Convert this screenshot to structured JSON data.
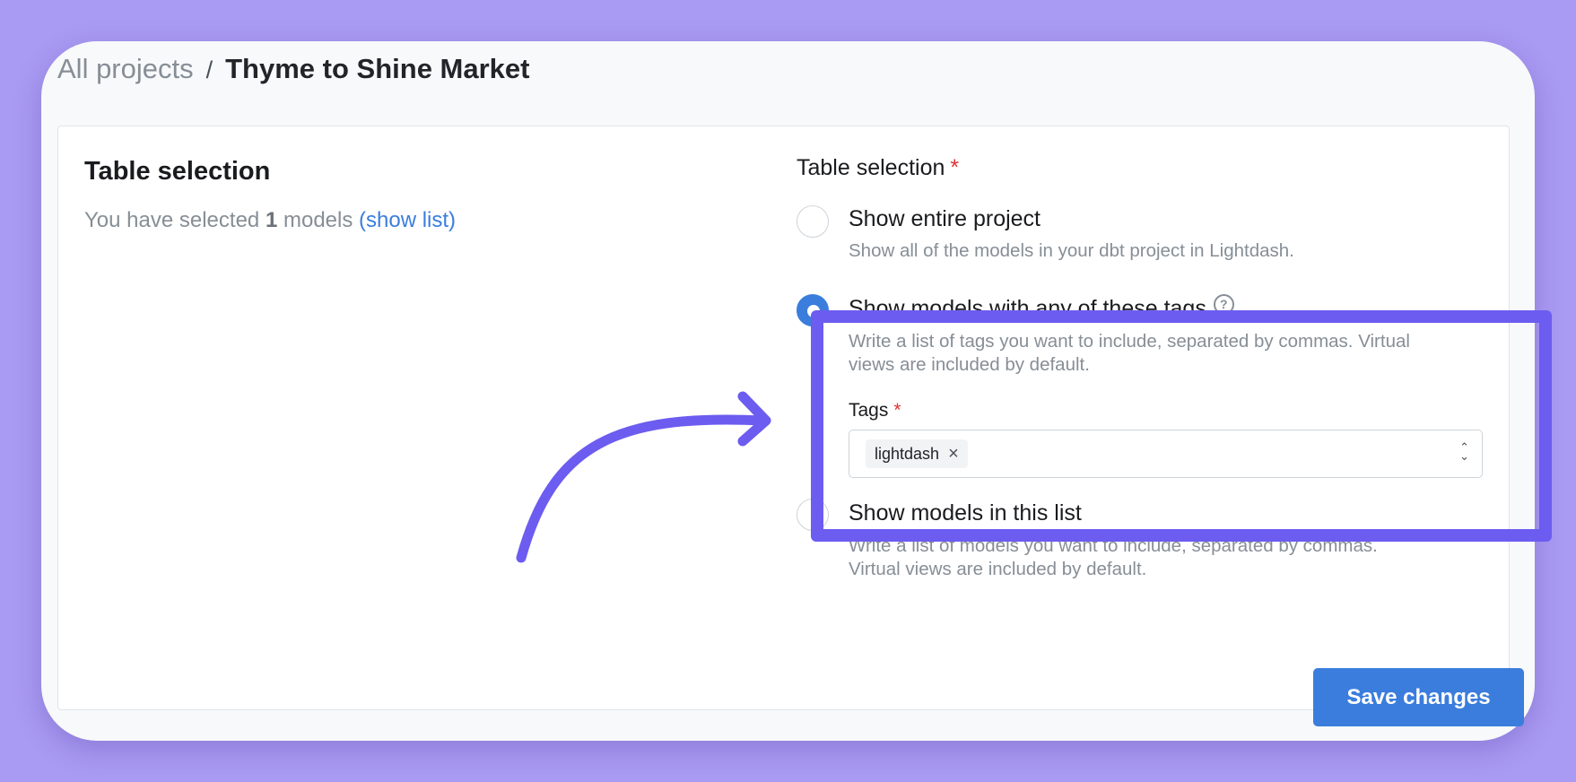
{
  "breadcrumb": {
    "parent": "All projects",
    "separator": "/",
    "current": "Thyme to Shine Market"
  },
  "left": {
    "title": "Table selection",
    "desc_prefix": "You have selected",
    "count": "1",
    "desc_suffix": "models",
    "show_list": "(show list)"
  },
  "right": {
    "label": "Table selection",
    "required_mark": "*",
    "options": [
      {
        "label": "Show entire project",
        "description": "Show all of the models in your dbt project in Lightdash.",
        "checked": false
      },
      {
        "label": "Show models with any of these tags",
        "description_line1": "Write a list of tags you want to include, separated by commas. Virtual",
        "description_line2": "views are included by default.",
        "checked": true,
        "help_icon": "?"
      },
      {
        "label": "Show models in this list",
        "description_line1": "Write a list of models you want to include, separated by commas.",
        "description_line2": "Virtual views are included by default.",
        "checked": false
      }
    ],
    "tags": {
      "label": "Tags",
      "required_mark": "*",
      "values": [
        "lightdash"
      ],
      "remove_icon": "×"
    }
  },
  "save_button": "Save changes",
  "colors": {
    "accent": "#3b7ddd",
    "highlight": "#6c5cf0",
    "background": "#a99af3"
  }
}
